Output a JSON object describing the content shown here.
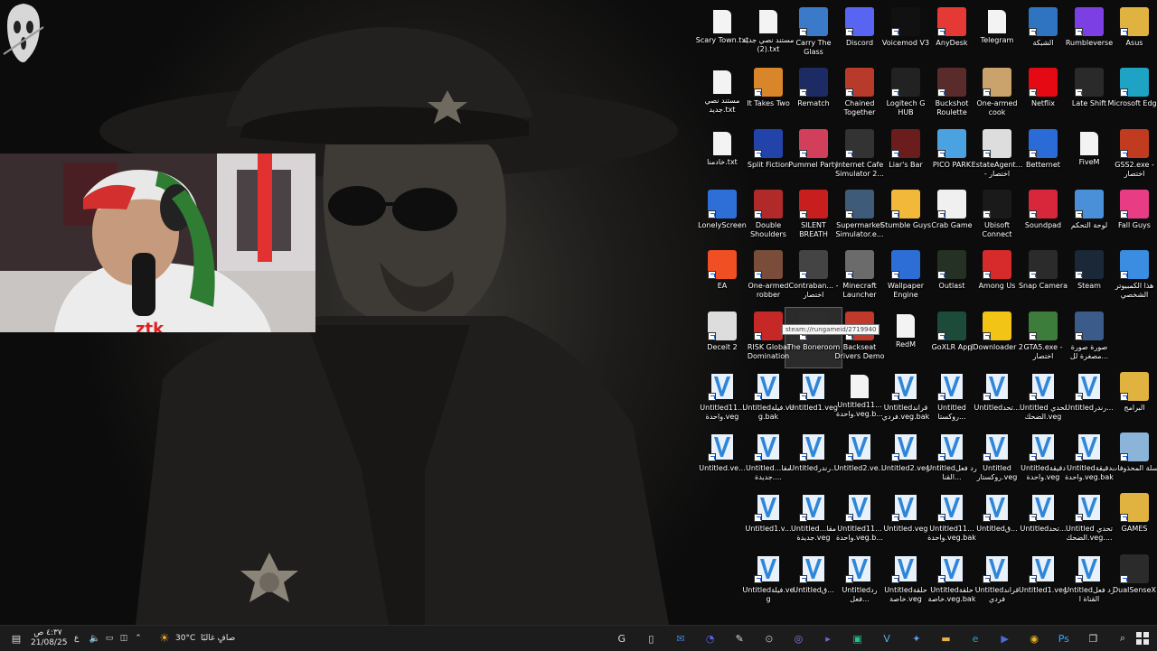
{
  "desktop": {
    "tooltip": "steam://rungameid/2719940",
    "icons": [
      {
        "label": "Scary Town.txt",
        "icon": "text-document-icon",
        "kind": "doc"
      },
      {
        "label": "مستند نصي جديد (2).txt",
        "icon": "text-document-icon",
        "kind": "doc"
      },
      {
        "label": "Carry The Glass",
        "icon": "game-carry-the-glass-icon",
        "color": "#3a7ac9"
      },
      {
        "label": "Discord",
        "icon": "discord-icon",
        "color": "#5865f2"
      },
      {
        "label": "Voicemod V3",
        "icon": "voicemod-icon",
        "color": "#111111"
      },
      {
        "label": "AnyDesk",
        "icon": "anydesk-icon",
        "color": "#e53935"
      },
      {
        "label": "Telegram",
        "icon": "text-document-icon",
        "kind": "doc"
      },
      {
        "label": "الشبكة",
        "icon": "network-icon",
        "color": "#2f74c0"
      },
      {
        "label": "Rumbleverse",
        "icon": "rumbleverse-icon",
        "color": "#7b3fe4"
      },
      {
        "label": "Asus",
        "icon": "folder-icon",
        "color": "#e0b341"
      },
      {
        "label": "مستند نصي جديد.txt",
        "icon": "text-document-icon",
        "kind": "doc"
      },
      {
        "label": "It Takes Two",
        "icon": "it-takes-two-icon",
        "color": "#d9862b"
      },
      {
        "label": "Rematch",
        "icon": "rematch-icon",
        "color": "#1d2b64"
      },
      {
        "label": "Chained Together",
        "icon": "chained-together-icon",
        "color": "#b83a2a"
      },
      {
        "label": "Logitech G HUB",
        "icon": "logitech-icon",
        "color": "#222222"
      },
      {
        "label": "Buckshot Roulette",
        "icon": "buckshot-roulette-icon",
        "color": "#5a2b2b"
      },
      {
        "label": "One-armed cook",
        "icon": "one-armed-cook-icon",
        "color": "#c9a36b"
      },
      {
        "label": "Netflix",
        "icon": "netflix-icon",
        "color": "#e50914"
      },
      {
        "label": "Late Shift",
        "icon": "late-shift-icon",
        "color": "#2a2a2a"
      },
      {
        "label": "Microsoft Edge",
        "icon": "edge-icon",
        "color": "#1fa3c4"
      },
      {
        "label": "خادمنا.txt",
        "icon": "text-document-icon",
        "kind": "doc"
      },
      {
        "label": "Split Fiction",
        "icon": "split-fiction-icon",
        "color": "#2244aa"
      },
      {
        "label": "Pummel Party",
        "icon": "pummel-party-icon",
        "color": "#d23f5a"
      },
      {
        "label": "Internet Cafe Simulator 2...",
        "icon": "internet-cafe-icon",
        "color": "#333333"
      },
      {
        "label": "Liar's Bar",
        "icon": "liars-bar-icon",
        "color": "#6b1d1d"
      },
      {
        "label": "PICO PARK",
        "icon": "pico-park-icon",
        "color": "#4aa3e0"
      },
      {
        "label": "EstateAgent... - اختصار",
        "icon": "estate-agent-icon",
        "color": "#dddddd"
      },
      {
        "label": "Betternet",
        "icon": "betternet-icon",
        "color": "#2a6bd8"
      },
      {
        "label": "FiveM",
        "icon": "text-document-icon",
        "kind": "doc"
      },
      {
        "label": "GSS2.exe - اختصار",
        "icon": "gss2-icon",
        "color": "#c03b1f"
      },
      {
        "label": "LonelyScreen",
        "icon": "lonelyscreen-icon",
        "color": "#2d6fd6"
      },
      {
        "label": "Double Shoulders",
        "icon": "double-shoulders-icon",
        "color": "#b02a2a"
      },
      {
        "label": "SILENT BREATH",
        "icon": "silent-breath-icon",
        "color": "#c81e1e"
      },
      {
        "label": "Supermarket Simulator.e...",
        "icon": "supermarket-simulator-icon",
        "color": "#3e5c79"
      },
      {
        "label": "Stumble Guys",
        "icon": "stumble-guys-icon",
        "color": "#f2b83a"
      },
      {
        "label": "Crab Game",
        "icon": "crab-game-icon",
        "color": "#f0f0f0"
      },
      {
        "label": "Ubisoft Connect",
        "icon": "ubisoft-icon",
        "color": "#1a1a1a"
      },
      {
        "label": "Soundpad",
        "icon": "soundpad-icon",
        "color": "#d8263a"
      },
      {
        "label": "لوحة التحكم",
        "icon": "control-panel-icon",
        "color": "#4a90d9"
      },
      {
        "label": "Fall Guys",
        "icon": "fall-guys-icon",
        "color": "#e83d84"
      },
      {
        "label": "EA",
        "icon": "ea-icon",
        "color": "#f04e23"
      },
      {
        "label": "One-armed robber",
        "icon": "one-armed-robber-icon",
        "color": "#7a4d3b"
      },
      {
        "label": "Contraban... - اختصار",
        "icon": "contraband-icon",
        "color": "#444444"
      },
      {
        "label": "Minecraft Launcher",
        "icon": "minecraft-icon",
        "color": "#6b6b6b"
      },
      {
        "label": "Wallpaper Engine",
        "icon": "wallpaper-engine-icon",
        "color": "#2c6ed5"
      },
      {
        "label": "Outlast",
        "icon": "outlast-icon",
        "color": "#263126"
      },
      {
        "label": "Among Us",
        "icon": "among-us-icon",
        "color": "#d72b2b"
      },
      {
        "label": "Snap Camera",
        "icon": "snap-camera-icon",
        "color": "#2b2b2b"
      },
      {
        "label": "Steam",
        "icon": "steam-icon",
        "color": "#1b2838"
      },
      {
        "label": "هذا الكمبيوتر الشخصي",
        "icon": "this-pc-icon",
        "color": "#3a8de0"
      },
      {
        "label": "Deceit 2",
        "icon": "deceit-2-icon",
        "color": "#dddddd"
      },
      {
        "label": "RISK Global Domination",
        "icon": "risk-icon",
        "color": "#c62828"
      },
      {
        "label": "The Boneroom",
        "icon": "boneroom-icon",
        "color": "#2d2d2d",
        "selected": true
      },
      {
        "label": "Backseat Drivers Demo",
        "icon": "backseat-drivers-icon",
        "color": "#c0392b"
      },
      {
        "label": "RedM",
        "icon": "text-document-icon",
        "kind": "doc"
      },
      {
        "label": "GoXLR App",
        "icon": "goxlr-icon",
        "color": "#1c4b3a"
      },
      {
        "label": "JDownloader 2",
        "icon": "jdownloader-icon",
        "color": "#f2c416"
      },
      {
        "label": "GTA5.exe - اختصار",
        "icon": "gta5-icon",
        "color": "#3c7d3c"
      },
      {
        "label": "صورة صورة مصغرة لل...",
        "icon": "image-file-icon",
        "color": "#3b5b8a"
      },
      {
        "label": "",
        "icon": "none",
        "kind": "blank"
      },
      {
        "label": "Untitled11... واحدة.veg",
        "icon": "vegas-project-icon",
        "kind": "veg"
      },
      {
        "label": "Untitledفيلة.veg.bak",
        "icon": "vegas-project-icon",
        "kind": "veg"
      },
      {
        "label": "Untitled1.veg",
        "icon": "vegas-project-icon",
        "kind": "veg"
      },
      {
        "label": "Untitled11... واحدة.veg.b...",
        "icon": "text-document-icon",
        "kind": "doc"
      },
      {
        "label": "Untitledقراند فردي.veg.bak",
        "icon": "vegas-project-icon",
        "kind": "veg"
      },
      {
        "label": "Untitled روكستا...",
        "icon": "vegas-project-icon",
        "kind": "veg"
      },
      {
        "label": "Untitledتحد...",
        "icon": "vegas-project-icon",
        "kind": "veg"
      },
      {
        "label": "Untitled تحدي الضحك.veg",
        "icon": "vegas-project-icon",
        "kind": "veg"
      },
      {
        "label": "Untitledرندر...",
        "icon": "vegas-project-icon",
        "kind": "veg"
      },
      {
        "label": "البرامج",
        "icon": "programs-folder-icon",
        "color": "#e0b341"
      },
      {
        "label": "Untitled.ve...",
        "icon": "vegas-project-icon",
        "kind": "veg"
      },
      {
        "label": "Untitledمقا... جديدة....",
        "icon": "vegas-project-icon",
        "kind": "veg"
      },
      {
        "label": "Untitledرندر...",
        "icon": "vegas-project-icon",
        "kind": "veg"
      },
      {
        "label": "Untitled2.ve...",
        "icon": "vegas-project-icon",
        "kind": "veg"
      },
      {
        "label": "Untitled2.veg",
        "icon": "vegas-project-icon",
        "kind": "veg"
      },
      {
        "label": "Untitledرد فعل القنا...",
        "icon": "vegas-project-icon",
        "kind": "veg"
      },
      {
        "label": "Untitled روكستار.veg",
        "icon": "vegas-project-icon",
        "kind": "veg"
      },
      {
        "label": "Untitledدقيقة واحدة.veg",
        "icon": "vegas-project-icon",
        "kind": "veg"
      },
      {
        "label": "Untitledدقيقة واحدة.veg.bak",
        "icon": "vegas-project-icon",
        "kind": "veg"
      },
      {
        "label": "سلة المحذوفات",
        "icon": "recycle-bin-icon",
        "color": "#8ab4d8"
      },
      {
        "label": "",
        "icon": "none",
        "kind": "blank"
      },
      {
        "label": "Untitled1.v...",
        "icon": "vegas-project-icon",
        "kind": "veg"
      },
      {
        "label": "Untitledمقا... جديدة.veg",
        "icon": "vegas-project-icon",
        "kind": "veg"
      },
      {
        "label": "Untitled11... واحدة.veg.b...",
        "icon": "vegas-project-icon",
        "kind": "veg"
      },
      {
        "label": "Untitled.veg",
        "icon": "vegas-project-icon",
        "kind": "veg"
      },
      {
        "label": "Untitled11... واحدة.veg.bak",
        "icon": "vegas-project-icon",
        "kind": "veg"
      },
      {
        "label": "Untitledق...",
        "icon": "vegas-project-icon",
        "kind": "veg"
      },
      {
        "label": "Untitledتحد...",
        "icon": "vegas-project-icon",
        "kind": "veg"
      },
      {
        "label": "Untitled تحدي الضحك.veg....",
        "icon": "vegas-project-icon",
        "kind": "veg"
      },
      {
        "label": "GAMES",
        "icon": "games-folder-icon",
        "color": "#e0b341"
      },
      {
        "label": "",
        "icon": "none",
        "kind": "blank"
      },
      {
        "label": "Untitledفيلة.veg",
        "icon": "vegas-project-icon",
        "kind": "veg"
      },
      {
        "label": "Untitledق...",
        "icon": "vegas-project-icon",
        "kind": "veg"
      },
      {
        "label": "Untitledرد فعل...",
        "icon": "vegas-project-icon",
        "kind": "veg"
      },
      {
        "label": "Untitledحلقة خاصة.veg",
        "icon": "vegas-project-icon",
        "kind": "veg"
      },
      {
        "label": "Untitledحلقة خاصة.veg.bak",
        "icon": "vegas-project-icon",
        "kind": "veg"
      },
      {
        "label": "Untitledقراند فردي",
        "icon": "vegas-project-icon",
        "kind": "veg"
      },
      {
        "label": "Untitled1.veg",
        "icon": "vegas-project-icon",
        "kind": "veg"
      },
      {
        "label": "Untitledرد فعل القناة ا",
        "icon": "vegas-project-icon",
        "kind": "veg"
      },
      {
        "label": "DualSenseX",
        "icon": "dualsensex-icon",
        "color": "#2b2b2b"
      }
    ]
  },
  "taskbar": {
    "clock_time": "٤:٣٧ ص",
    "clock_date": "21/08/25",
    "lang": "ع",
    "weather_temp": "30°C",
    "weather_text": "صافٍ غالبًا",
    "apps": [
      {
        "icon": "search-icon",
        "glyph": "⌕"
      },
      {
        "icon": "task-view-icon",
        "glyph": "❐"
      },
      {
        "icon": "ps-icon",
        "glyph": "Ps",
        "color": "#31a8ff"
      },
      {
        "icon": "chrome-icon",
        "glyph": "◉",
        "color": "#e8b323"
      },
      {
        "icon": "media-icon",
        "glyph": "▶",
        "color": "#4a6bd8"
      },
      {
        "icon": "edge-icon",
        "glyph": "e",
        "color": "#1fa3c4"
      },
      {
        "icon": "file-explorer-icon",
        "glyph": "▬",
        "color": "#e0b341"
      },
      {
        "icon": "tool-icon",
        "glyph": "✦",
        "color": "#5aa0f0"
      },
      {
        "icon": "vegas-icon",
        "glyph": "V",
        "color": "#4fb2ec"
      },
      {
        "icon": "xbox-bar-icon",
        "glyph": "▣",
        "color": "#22c18a"
      },
      {
        "icon": "player-icon",
        "glyph": "▸",
        "color": "#7b5fd8"
      },
      {
        "icon": "obs-icon",
        "glyph": "◎",
        "color": "#9a7ae8"
      },
      {
        "icon": "capcut-icon",
        "glyph": "⊙",
        "color": "#b0b0b0"
      },
      {
        "icon": "notepad-icon",
        "glyph": "✎",
        "color": "#dddddd"
      },
      {
        "icon": "discord-icon",
        "glyph": "◔",
        "color": "#5865f2"
      },
      {
        "icon": "outlook-icon",
        "glyph": "✉",
        "color": "#3b82d6"
      },
      {
        "icon": "file-icon",
        "glyph": "▯",
        "color": "#dddddd"
      },
      {
        "icon": "google-icon",
        "glyph": "G",
        "color": "#dddddd"
      }
    ]
  }
}
